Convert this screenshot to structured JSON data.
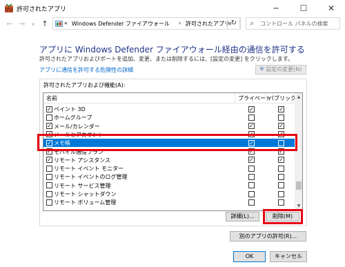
{
  "window": {
    "title": "許可されたアプリ",
    "minimize_glyph": "─",
    "maximize_glyph": "☐",
    "close_glyph": "✕"
  },
  "address_bar": {
    "back_glyph": "←",
    "forward_glyph": "→",
    "up_glyph": "↑",
    "overflow": "«",
    "crumbs": [
      "Windows Defender ファイアウォール",
      "許可されたアプリ"
    ],
    "separator": "›",
    "dropdown_glyph": "∨",
    "refresh_glyph": "↻",
    "search_placeholder": "コントロール パネルの検索",
    "search_glyph": "⌕"
  },
  "page": {
    "heading": "アプリに Windows Defender ファイアウォール経由の通信を許可する",
    "description": "許可されたアプリおよびポートを追加、変更、または削除するには、[設定の変更] をクリックします。",
    "risk_link": "アプリに通信を許可する危険性の詳細",
    "change_settings_label": "設定の変更(N)",
    "shield_glyph": "⛨",
    "group_label": "許可されたアプリおよび機能(A):"
  },
  "list": {
    "col_name": "名前",
    "col_private": "プライベート",
    "col_public": "パブリック",
    "up_glyph": "▲",
    "down_glyph": "▼",
    "rows": [
      {
        "name": "ペイント 3D",
        "checked": true,
        "private": true,
        "public": true,
        "selected": false
      },
      {
        "name": "ホームグループ",
        "checked": false,
        "private": false,
        "public": false,
        "selected": false
      },
      {
        "name": "メール/カレンダー",
        "checked": true,
        "private": true,
        "public": true,
        "selected": false
      },
      {
        "name": "メールとアカウント",
        "checked": true,
        "private": true,
        "public": true,
        "selected": false
      },
      {
        "name": "メモ帳",
        "checked": true,
        "private": true,
        "public": false,
        "selected": true
      },
      {
        "name": "モバイル通信プラン",
        "checked": true,
        "private": true,
        "public": true,
        "selected": false
      },
      {
        "name": "リモート アシスタンス",
        "checked": true,
        "private": true,
        "public": true,
        "selected": false
      },
      {
        "name": "リモート イベント モニター",
        "checked": false,
        "private": false,
        "public": false,
        "selected": false
      },
      {
        "name": "リモート イベントのログ管理",
        "checked": false,
        "private": false,
        "public": false,
        "selected": false
      },
      {
        "name": "リモート サービス管理",
        "checked": false,
        "private": false,
        "public": false,
        "selected": false
      },
      {
        "name": "リモート シャットダウン",
        "checked": false,
        "private": false,
        "public": false,
        "selected": false
      },
      {
        "name": "リモート ボリューム管理",
        "checked": false,
        "private": false,
        "public": false,
        "selected": false
      }
    ]
  },
  "buttons": {
    "details": "詳細(L)...",
    "remove": "削除(M)",
    "allow_other": "別のアプリの許可(R)...",
    "ok": "OK",
    "cancel": "キャンセル"
  },
  "check_glyph": "✓",
  "colors": {
    "heading": "#1e3287",
    "link": "#0066cc",
    "selection": "#0078d7",
    "highlight_red": "#e60012"
  }
}
